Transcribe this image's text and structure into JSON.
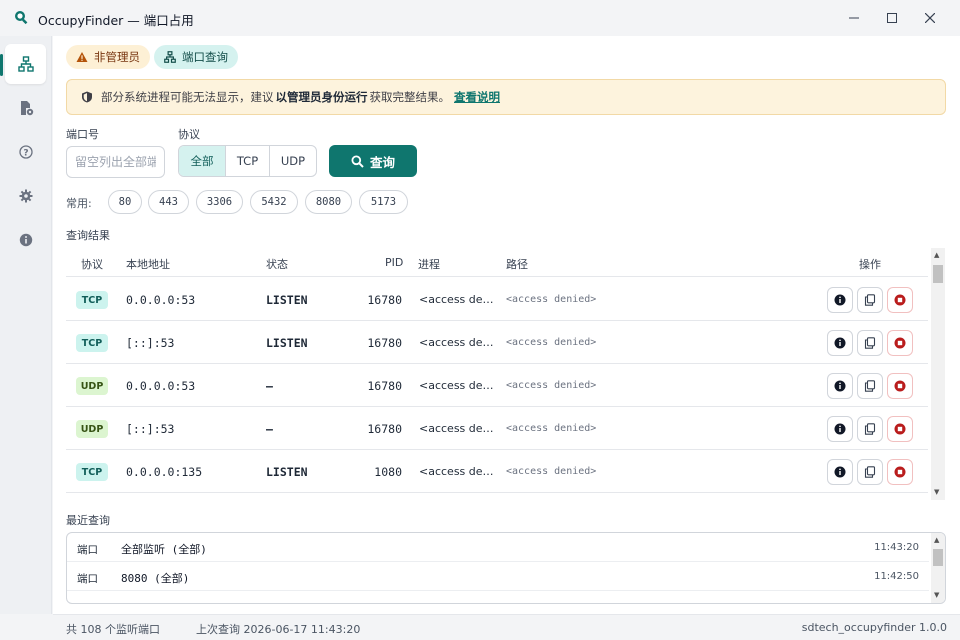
{
  "window": {
    "title": "OccupyFinder — 端口占用",
    "brand_color": "#0f766e"
  },
  "sidebar": {
    "items": [
      {
        "name": "network",
        "icon": "network-icon",
        "active": true
      },
      {
        "name": "file-process",
        "icon": "file-process-icon",
        "active": false
      },
      {
        "name": "help",
        "icon": "help-icon",
        "active": false
      },
      {
        "name": "settings",
        "icon": "gear-icon",
        "active": false
      },
      {
        "name": "about",
        "icon": "info-icon",
        "active": false
      }
    ]
  },
  "chips": {
    "non_admin": "非管理员",
    "port_query": "端口查询"
  },
  "banner": {
    "text_before": "部分系统进程可能无法显示，建议",
    "bold": "以管理员身份运行",
    "text_after": "获取完整结果。",
    "link": "查看说明"
  },
  "form": {
    "port_label": "端口号",
    "port_placeholder": "留空列出全部端口",
    "port_value": "",
    "protocol_label": "协议",
    "protocols": [
      "全部",
      "TCP",
      "UDP"
    ],
    "selected_protocol": "全部",
    "query_button": "查询"
  },
  "common": {
    "label": "常用:",
    "ports": [
      "80",
      "443",
      "3306",
      "5432",
      "8080",
      "5173"
    ]
  },
  "results": {
    "title": "查询结果",
    "columns": {
      "protocol": "协议",
      "local_address": "本地地址",
      "state": "状态",
      "pid": "PID",
      "process": "进程",
      "path": "路径",
      "actions": "操作"
    },
    "rows": [
      {
        "protocol": "TCP",
        "address": "0.0.0.0:53",
        "state": "LISTEN",
        "pid": "16780",
        "process": "<access de…",
        "path": "<access denied>"
      },
      {
        "protocol": "TCP",
        "address": "[::]:53",
        "state": "LISTEN",
        "pid": "16780",
        "process": "<access de…",
        "path": "<access denied>"
      },
      {
        "protocol": "UDP",
        "address": "0.0.0.0:53",
        "state": "—",
        "pid": "16780",
        "process": "<access de…",
        "path": "<access denied>"
      },
      {
        "protocol": "UDP",
        "address": "[::]:53",
        "state": "—",
        "pid": "16780",
        "process": "<access de…",
        "path": "<access denied>"
      },
      {
        "protocol": "TCP",
        "address": "0.0.0.0:135",
        "state": "LISTEN",
        "pid": "1080",
        "process": "<access de…",
        "path": "<access denied>"
      }
    ]
  },
  "recent": {
    "title": "最近查询",
    "rows": [
      {
        "kind": "端口",
        "value": "全部监听 (全部)",
        "time": "11:43:20"
      },
      {
        "kind": "端口",
        "value": "8080 (全部)",
        "time": "11:42:50"
      }
    ]
  },
  "status": {
    "count": "共 108 个监听端口",
    "last_query": "上次查询 2026-06-17 11:43:20",
    "version": "sdtech_occupyfinder 1.0.0"
  }
}
